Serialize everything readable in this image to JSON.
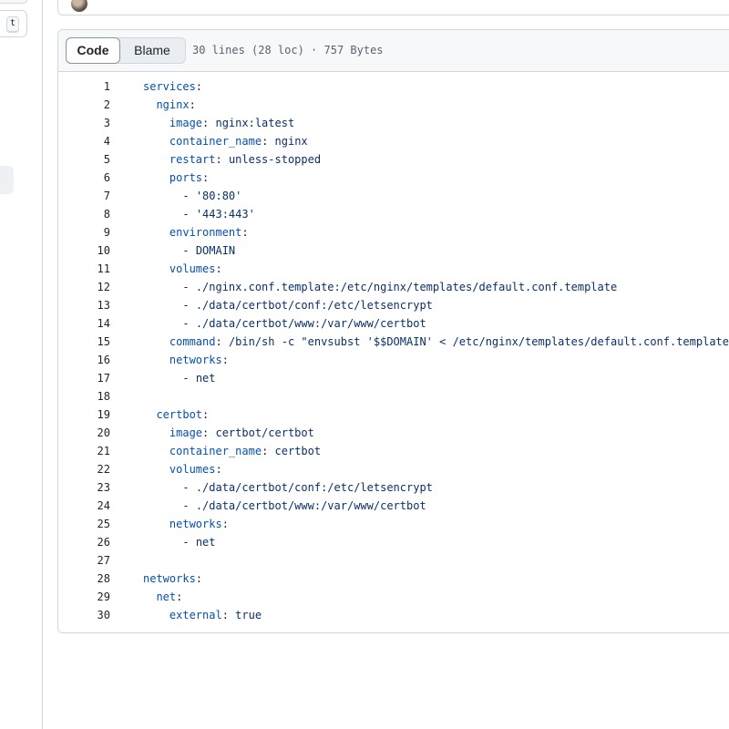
{
  "sidebar": {
    "shortcut_key": "t"
  },
  "file_header": {
    "tabs": [
      "Code",
      "Blame"
    ],
    "meta": "30 lines (28 loc) · 757 Bytes"
  },
  "code_lines": [
    {
      "n": "1",
      "indent": "",
      "key": "services",
      "sep": ":",
      "val": ""
    },
    {
      "n": "2",
      "indent": "  ",
      "key": "nginx",
      "sep": ":",
      "val": ""
    },
    {
      "n": "3",
      "indent": "    ",
      "key": "image",
      "sep": ": ",
      "val": "nginx:latest"
    },
    {
      "n": "4",
      "indent": "    ",
      "key": "container_name",
      "sep": ": ",
      "val": "nginx"
    },
    {
      "n": "5",
      "indent": "    ",
      "key": "restart",
      "sep": ": ",
      "val": "unless-stopped"
    },
    {
      "n": "6",
      "indent": "    ",
      "key": "ports",
      "sep": ":",
      "val": ""
    },
    {
      "n": "7",
      "indent": "      ",
      "key": "",
      "sep": "- ",
      "val": "'80:80'"
    },
    {
      "n": "8",
      "indent": "      ",
      "key": "",
      "sep": "- ",
      "val": "'443:443'"
    },
    {
      "n": "9",
      "indent": "    ",
      "key": "environment",
      "sep": ":",
      "val": ""
    },
    {
      "n": "10",
      "indent": "      ",
      "key": "",
      "sep": "- ",
      "val": "DOMAIN"
    },
    {
      "n": "11",
      "indent": "    ",
      "key": "volumes",
      "sep": ":",
      "val": ""
    },
    {
      "n": "12",
      "indent": "      ",
      "key": "",
      "sep": "- ",
      "val": "./nginx.conf.template:/etc/nginx/templates/default.conf.template"
    },
    {
      "n": "13",
      "indent": "      ",
      "key": "",
      "sep": "- ",
      "val": "./data/certbot/conf:/etc/letsencrypt"
    },
    {
      "n": "14",
      "indent": "      ",
      "key": "",
      "sep": "- ",
      "val": "./data/certbot/www:/var/www/certbot"
    },
    {
      "n": "15",
      "indent": "    ",
      "key": "command",
      "sep": ": ",
      "val": "/bin/sh -c \"envsubst '$$DOMAIN' < /etc/nginx/templates/default.conf.template"
    },
    {
      "n": "16",
      "indent": "    ",
      "key": "networks",
      "sep": ":",
      "val": ""
    },
    {
      "n": "17",
      "indent": "      ",
      "key": "",
      "sep": "- ",
      "val": "net"
    },
    {
      "n": "18",
      "indent": "",
      "key": "",
      "sep": "",
      "val": ""
    },
    {
      "n": "19",
      "indent": "  ",
      "key": "certbot",
      "sep": ":",
      "val": ""
    },
    {
      "n": "20",
      "indent": "    ",
      "key": "image",
      "sep": ": ",
      "val": "certbot/certbot"
    },
    {
      "n": "21",
      "indent": "    ",
      "key": "container_name",
      "sep": ": ",
      "val": "certbot"
    },
    {
      "n": "22",
      "indent": "    ",
      "key": "volumes",
      "sep": ":",
      "val": ""
    },
    {
      "n": "23",
      "indent": "      ",
      "key": "",
      "sep": "- ",
      "val": "./data/certbot/conf:/etc/letsencrypt"
    },
    {
      "n": "24",
      "indent": "      ",
      "key": "",
      "sep": "- ",
      "val": "./data/certbot/www:/var/www/certbot"
    },
    {
      "n": "25",
      "indent": "    ",
      "key": "networks",
      "sep": ":",
      "val": ""
    },
    {
      "n": "26",
      "indent": "      ",
      "key": "",
      "sep": "- ",
      "val": "net"
    },
    {
      "n": "27",
      "indent": "",
      "key": "",
      "sep": "",
      "val": ""
    },
    {
      "n": "28",
      "indent": "",
      "key": "networks",
      "sep": ":",
      "val": ""
    },
    {
      "n": "29",
      "indent": "  ",
      "key": "net",
      "sep": ":",
      "val": ""
    },
    {
      "n": "30",
      "indent": "    ",
      "key": "external",
      "sep": ": ",
      "val": "true"
    }
  ]
}
